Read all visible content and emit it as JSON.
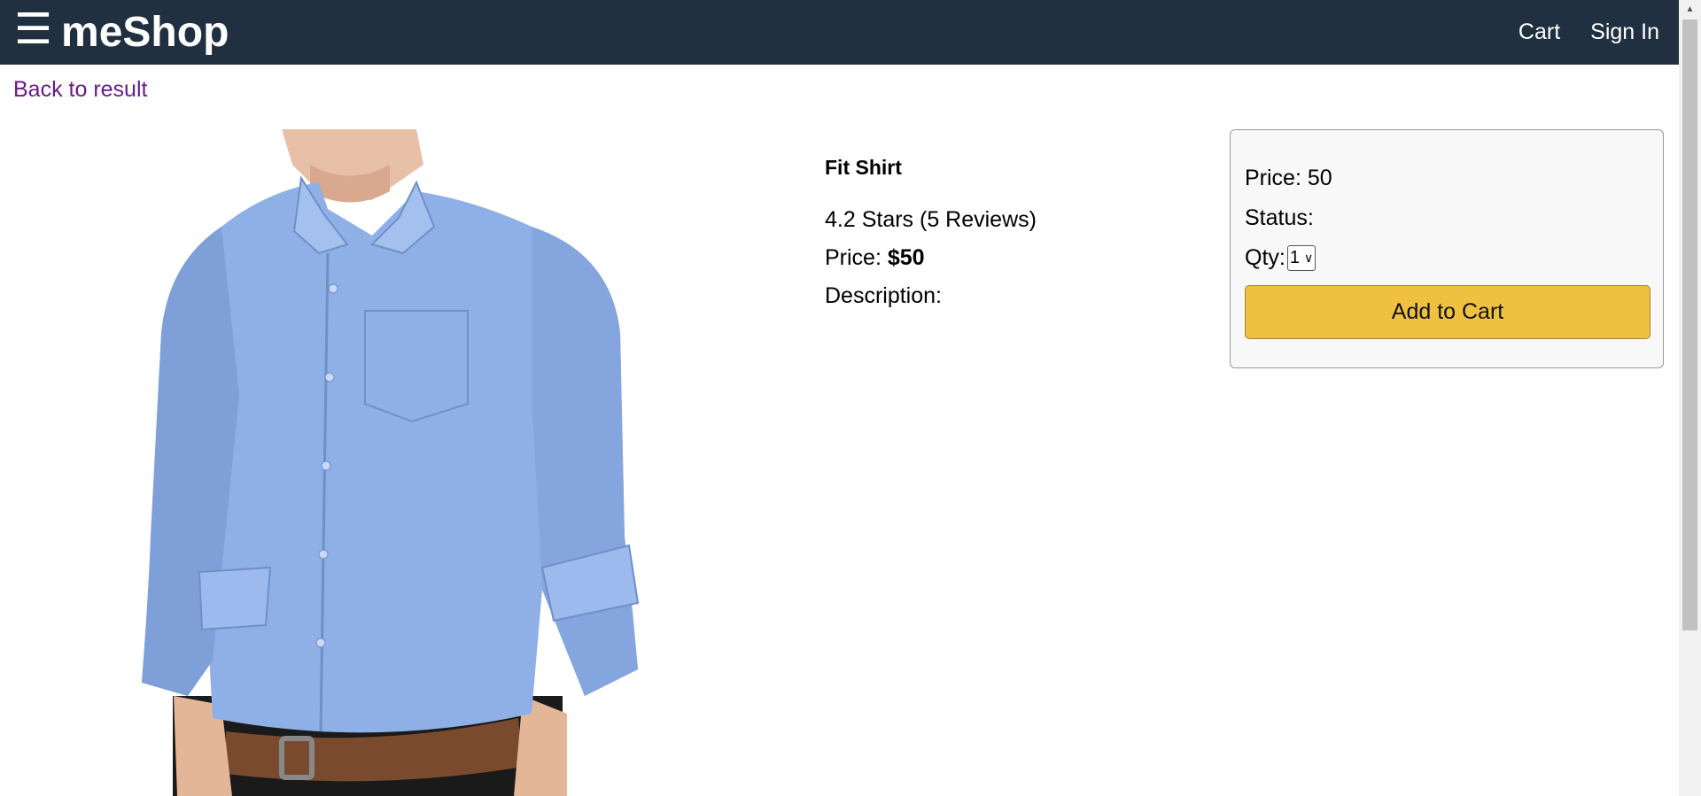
{
  "header": {
    "menu_glyph": "☰",
    "brand": "meShop",
    "links": {
      "cart": "Cart",
      "sign_in": "Sign In"
    }
  },
  "back_link": "Back to result",
  "product": {
    "name": "Fit Shirt",
    "rating_text": "4.2 Stars (5 Reviews)",
    "price_label": "Price: ",
    "price_value": "$50",
    "description_label": "Description:"
  },
  "action": {
    "price": "Price: 50",
    "status": "Status:",
    "qty_label": "Qty:",
    "qty_selected": "1",
    "add_button": "Add to Cart"
  },
  "colors": {
    "header_bg": "#203040",
    "button_bg": "#f0c040",
    "shirt": "#8fb0e6"
  }
}
